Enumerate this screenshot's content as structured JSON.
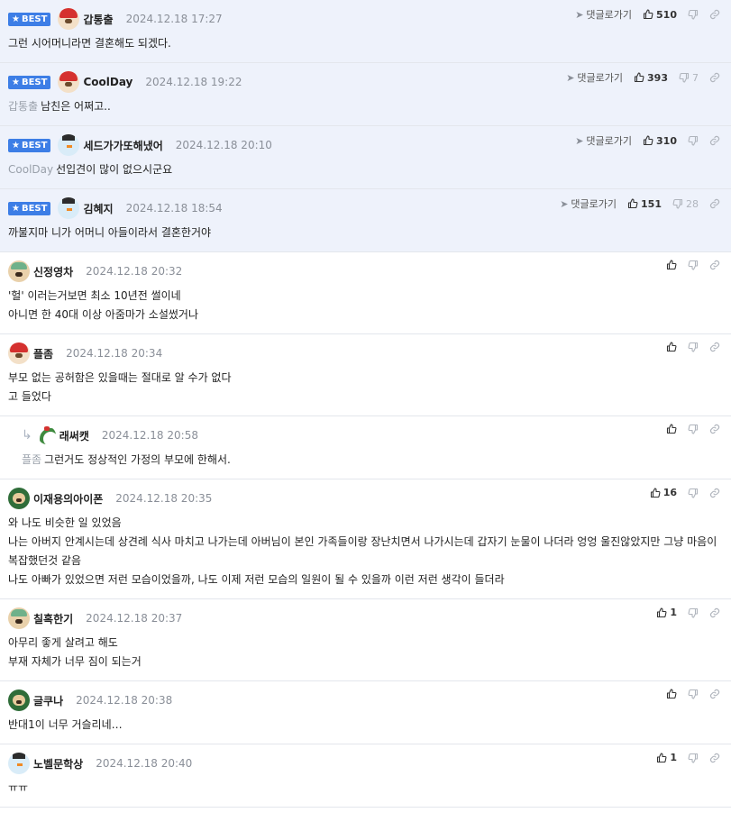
{
  "labels": {
    "best": "BEST",
    "goto": "댓글로가기"
  },
  "colors": {
    "best_badge": "#3d7ee6",
    "best_row_bg": "#eef2fb"
  },
  "icons": {
    "like": "thumbs-up-icon",
    "dislike": "thumbs-down-icon",
    "link": "link-icon",
    "goto_arrow": "send-arrow-icon",
    "reply": "reply-arrow-icon"
  },
  "comments": [
    {
      "best": true,
      "avatar": "santa",
      "nick": "갑통출",
      "date": "2024.12.18 17:27",
      "mention": "",
      "lines": [
        "그런 시어머니라면 결혼해도 되겠다."
      ],
      "goto": true,
      "likes": "510",
      "dislikes": ""
    },
    {
      "best": true,
      "avatar": "santa",
      "nick": "CoolDay",
      "date": "2024.12.18 19:22",
      "mention": "갑통출",
      "lines": [
        "남친은 어쩌고.."
      ],
      "goto": true,
      "likes": "393",
      "dislikes": "7"
    },
    {
      "best": true,
      "avatar": "snow",
      "nick": "세드가가또해냈어",
      "date": "2024.12.18 20:10",
      "mention": "CoolDay",
      "lines": [
        "선입견이 많이 없으시군요"
      ],
      "goto": true,
      "likes": "310",
      "dislikes": ""
    },
    {
      "best": true,
      "avatar": "snow",
      "nick": "김혜지",
      "date": "2024.12.18 18:54",
      "mention": "",
      "lines": [
        "까불지마 니가 어머니 아들이라서 결혼한거야"
      ],
      "goto": true,
      "likes": "151",
      "dislikes": "28"
    },
    {
      "best": false,
      "avatar": "dog",
      "nick": "신정영차",
      "date": "2024.12.18 20:32",
      "mention": "",
      "lines": [
        "'헐' 이러는거보면 최소 10년전 썰이네",
        "아니면 한 40대 이상 아줌마가 소설썼거나"
      ],
      "goto": false,
      "likes": "",
      "dislikes": ""
    },
    {
      "best": false,
      "avatar": "santa",
      "nick": "플좀",
      "date": "2024.12.18 20:34",
      "mention": "",
      "lines": [
        "부모 없는 공허함은 있을때는 절대로 알 수가 없다",
        "고 들었다"
      ],
      "goto": false,
      "likes": "",
      "dislikes": ""
    },
    {
      "best": false,
      "reply": true,
      "avatar": "wreath",
      "nick": "래써캣",
      "date": "2024.12.18 20:58",
      "mention": "플좀",
      "lines": [
        "그런거도 정상적인 가정의 부모에 한해서."
      ],
      "goto": false,
      "likes": "",
      "dislikes": ""
    },
    {
      "best": false,
      "avatar": "green",
      "nick": "이재용의아이폰",
      "date": "2024.12.18 20:35",
      "mention": "",
      "lines": [
        "와 나도 비슷한 일 있었음",
        "나는 아버지 안계시는데 상견례 식사 마치고 나가는데 아버님이 본인 가족들이랑 장난치면서 나가시는데 갑자기 눈물이 나더라 엉엉 울진않았지만 그냥 마음이",
        "복잡했던것 같음",
        "나도 아빠가 있었으면 저런 모습이었을까, 나도 이제 저런 모습의 일원이 될 수 있을까 이런 저런 생각이 들더라"
      ],
      "goto": false,
      "likes": "16",
      "dislikes": ""
    },
    {
      "best": false,
      "avatar": "dog",
      "nick": "칠혹한기",
      "date": "2024.12.18 20:37",
      "mention": "",
      "lines": [
        "아무리 좋게 살려고 해도",
        "부재 자체가 너무 짐이 되는거"
      ],
      "goto": false,
      "likes": "1",
      "dislikes": ""
    },
    {
      "best": false,
      "avatar": "green",
      "nick": "글쿠나",
      "date": "2024.12.18 20:38",
      "mention": "",
      "lines": [
        "반대1이 너무 거슬리네…"
      ],
      "goto": false,
      "likes": "",
      "dislikes": ""
    },
    {
      "best": false,
      "avatar": "snow",
      "nick": "노벨문학상",
      "date": "2024.12.18 20:40",
      "mention": "",
      "lines": [
        "ㅠㅠ"
      ],
      "goto": false,
      "likes": "1",
      "dislikes": ""
    }
  ]
}
